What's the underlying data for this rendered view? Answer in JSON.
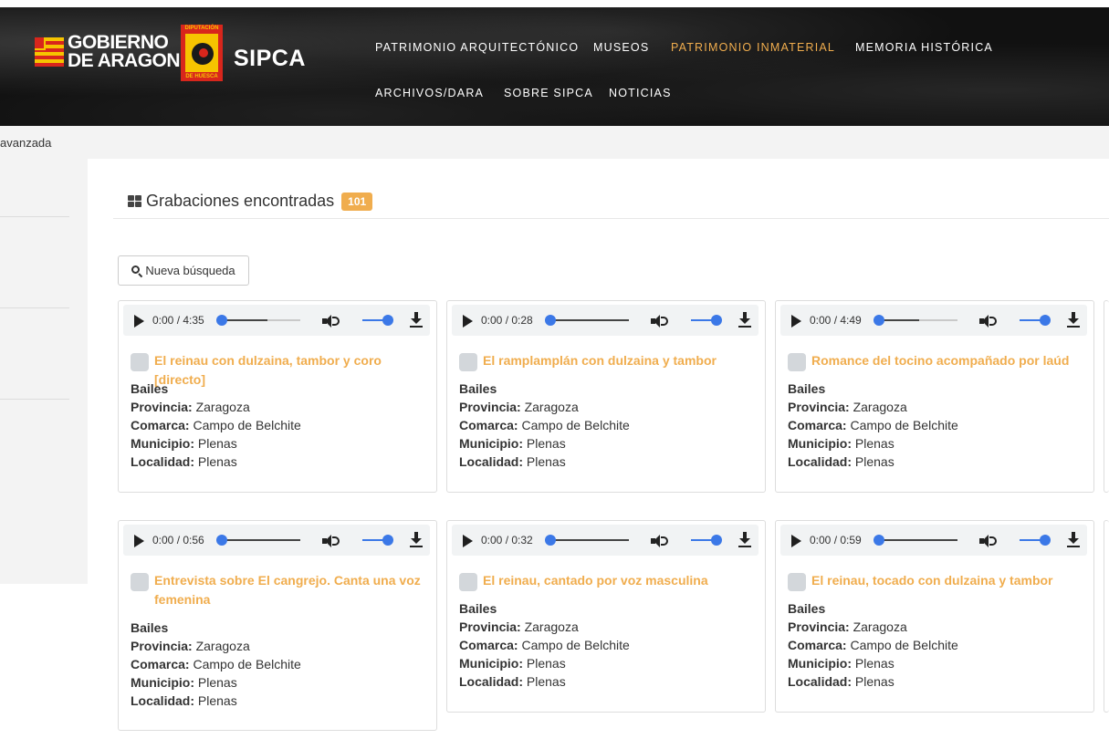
{
  "header": {
    "logo_text_line1": "GOBIERNO",
    "logo_text_line2": "DE ARAGON",
    "dph_caption_top": "DIPUTACIÓN",
    "dph_caption_bottom": "DE HUESCA",
    "site_name": "SIPCA",
    "nav": [
      {
        "label": "PATRIMONIO ARQUITECTÓNICO",
        "active": false
      },
      {
        "label": "MUSEOS",
        "active": false
      },
      {
        "label": "PATRIMONIO INMATERIAL",
        "active": true
      },
      {
        "label": "MEMORIA HISTÓRICA",
        "active": false
      },
      {
        "label": "ARCHIVOS/DARA",
        "active": false
      },
      {
        "label": "SOBRE SIPCA",
        "active": false
      },
      {
        "label": "NOTICIAS",
        "active": false
      }
    ]
  },
  "breadcrumb": {
    "text": "avanzada"
  },
  "results": {
    "title": "Grabaciones encontradas",
    "count": "101",
    "new_search_label": "Nueva búsqueda"
  },
  "labels": {
    "provincia": "Provincia:",
    "comarca": "Comarca:",
    "municipio": "Municipio:",
    "localidad": "Localidad:"
  },
  "cards": [
    {
      "time": "0:00 / 4:35",
      "title": "El reinau con dulzaina, tambor y coro [directo]",
      "category": "Bailes",
      "provincia": "Zaragoza",
      "comarca": "Campo de Belchite",
      "municipio": "Plenas",
      "localidad": "Plenas"
    },
    {
      "time": "0:00 / 0:28",
      "title": "El ramplamplán con dulzaina y tambor",
      "category": "Bailes",
      "provincia": "Zaragoza",
      "comarca": "Campo de Belchite",
      "municipio": "Plenas",
      "localidad": "Plenas"
    },
    {
      "time": "0:00 / 4:49",
      "title": "Romance del tocino acompañado por laúd",
      "category": "Bailes",
      "provincia": "Zaragoza",
      "comarca": "Campo de Belchite",
      "municipio": "Plenas",
      "localidad": "Plenas"
    },
    {
      "time": "0:00 / 0:56",
      "title": "Entrevista sobre El cangrejo. Canta una voz femenina",
      "category": "Bailes",
      "provincia": "Zaragoza",
      "comarca": "Campo de Belchite",
      "municipio": "Plenas",
      "localidad": "Plenas"
    },
    {
      "time": "0:00 / 0:32",
      "title": "El reinau, cantado por voz masculina",
      "category": "Bailes",
      "provincia": "Zaragoza",
      "comarca": "Campo de Belchite",
      "municipio": "Plenas",
      "localidad": "Plenas"
    },
    {
      "time": "0:00 / 0:59",
      "title": "El reinau, tocado con dulzaina y tambor",
      "category": "Bailes",
      "provincia": "Zaragoza",
      "comarca": "Campo de Belchite",
      "municipio": "Plenas",
      "localidad": "Plenas"
    }
  ],
  "colors": {
    "accent": "#f0ad4e",
    "slider": "#3b78e7",
    "header_bg": "#111111"
  }
}
